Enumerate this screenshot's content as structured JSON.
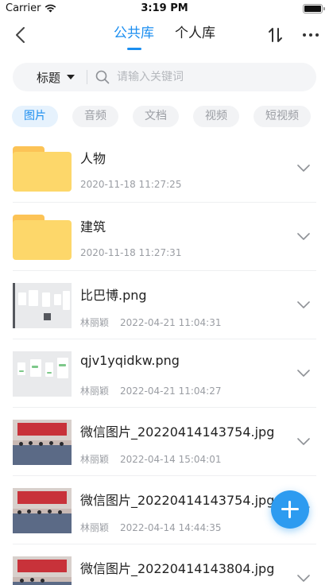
{
  "status_bar": {
    "carrier": "Carrier",
    "time": "3:19 PM"
  },
  "nav": {
    "tabs": [
      {
        "label": "公共库",
        "active": true
      },
      {
        "label": "个人库",
        "active": false
      }
    ],
    "icons": {
      "back": "chevron-left-icon",
      "sort": "sort-updown-icon",
      "more": "more-horizontal-icon"
    }
  },
  "search": {
    "field": "标题",
    "placeholder": "请输入关键词"
  },
  "filters": [
    {
      "label": "图片",
      "active": true
    },
    {
      "label": "音频",
      "active": false
    },
    {
      "label": "文档",
      "active": false
    },
    {
      "label": "视频",
      "active": false
    },
    {
      "label": "短视频",
      "active": false
    }
  ],
  "files": [
    {
      "type": "folder",
      "name": "人物",
      "owner": "",
      "time": "2020-11-18 11:27:25"
    },
    {
      "type": "folder",
      "name": "建筑",
      "owner": "",
      "time": "2020-11-18 11:27:31"
    },
    {
      "type": "screenshot",
      "name": "比巴博.png",
      "owner": "林丽颖",
      "time": "2022-04-21 11:04:31"
    },
    {
      "type": "screenshot",
      "name": "qjv1yqidkw.png",
      "owner": "林丽颖",
      "time": "2022-04-21 11:04:27"
    },
    {
      "type": "photo",
      "name": "微信图片_20220414143754.jpg",
      "owner": "林丽颖",
      "time": "2022-04-14 15:04:01"
    },
    {
      "type": "photo",
      "name": "微信图片_20220414143754.jpg",
      "owner": "林丽颖",
      "time": "2022-04-14 14:44:35"
    },
    {
      "type": "photo",
      "name": "微信图片_20220414143804.jpg",
      "owner": "",
      "time": ""
    }
  ],
  "colors": {
    "accent": "#1b8ef0",
    "folder": "#fdd76a",
    "fab": "#2d9bf0"
  },
  "fab": {
    "icon": "plus-icon"
  }
}
